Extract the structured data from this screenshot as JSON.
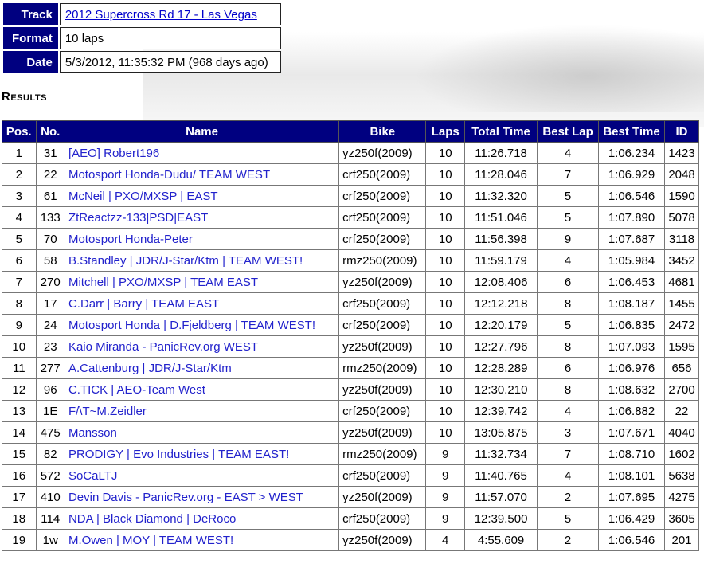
{
  "info": {
    "track_label": "Track",
    "track_value": "2012 Supercross Rd 17 - Las Vegas",
    "format_label": "Format",
    "format_value": "10 laps",
    "date_label": "Date",
    "date_value": "5/3/2012, 11:35:32 PM (968 days ago)"
  },
  "results": {
    "title": "Results",
    "headers": [
      "Pos.",
      "No.",
      "Name",
      "Bike",
      "Laps",
      "Total Time",
      "Best Lap",
      "Best Time",
      "ID"
    ],
    "rows": [
      [
        "1",
        "31",
        "[AEO] Robert196",
        "yz250f(2009)",
        "10",
        "11:26.718",
        "4",
        "1:06.234",
        "1423"
      ],
      [
        "2",
        "22",
        "Motosport Honda-Dudu/ TEAM WEST",
        "crf250(2009)",
        "10",
        "11:28.046",
        "7",
        "1:06.929",
        "2048"
      ],
      [
        "3",
        "61",
        "McNeil | PXO/MXSP | EAST",
        "crf250(2009)",
        "10",
        "11:32.320",
        "5",
        "1:06.546",
        "1590"
      ],
      [
        "4",
        "133",
        "ZtReactzz-133|PSD|EAST",
        "crf250(2009)",
        "10",
        "11:51.046",
        "5",
        "1:07.890",
        "5078"
      ],
      [
        "5",
        "70",
        "Motosport Honda-Peter",
        "crf250(2009)",
        "10",
        "11:56.398",
        "9",
        "1:07.687",
        "3118"
      ],
      [
        "6",
        "58",
        "B.Standley | JDR/J-Star/Ktm | TEAM WEST!",
        "rmz250(2009)",
        "10",
        "11:59.179",
        "4",
        "1:05.984",
        "3452"
      ],
      [
        "7",
        "270",
        "Mitchell | PXO/MXSP | TEAM EAST",
        "yz250f(2009)",
        "10",
        "12:08.406",
        "6",
        "1:06.453",
        "4681"
      ],
      [
        "8",
        "17",
        "C.Darr | Barry | TEAM EAST",
        "crf250(2009)",
        "10",
        "12:12.218",
        "8",
        "1:08.187",
        "1455"
      ],
      [
        "9",
        "24",
        "Motosport Honda | D.Fjeldberg | TEAM WEST!",
        "crf250(2009)",
        "10",
        "12:20.179",
        "5",
        "1:06.835",
        "2472"
      ],
      [
        "10",
        "23",
        "Kaio Miranda - PanicRev.org WEST",
        "yz250f(2009)",
        "10",
        "12:27.796",
        "8",
        "1:07.093",
        "1595"
      ],
      [
        "11",
        "277",
        "A.Cattenburg | JDR/J-Star/Ktm",
        "rmz250(2009)",
        "10",
        "12:28.289",
        "6",
        "1:06.976",
        "656"
      ],
      [
        "12",
        "96",
        "C.TICK | AEO-Team West",
        "yz250f(2009)",
        "10",
        "12:30.210",
        "8",
        "1:08.632",
        "2700"
      ],
      [
        "13",
        "1E",
        "F/\\T~M.Zeidler",
        "crf250(2009)",
        "10",
        "12:39.742",
        "4",
        "1:06.882",
        "22"
      ],
      [
        "14",
        "475",
        "Mansson",
        "yz250f(2009)",
        "10",
        "13:05.875",
        "3",
        "1:07.671",
        "4040"
      ],
      [
        "15",
        "82",
        "PRODIGY | Evo Industries | TEAM EAST!",
        "rmz250(2009)",
        "9",
        "11:32.734",
        "7",
        "1:08.710",
        "1602"
      ],
      [
        "16",
        "572",
        "SoCaLTJ",
        "crf250(2009)",
        "9",
        "11:40.765",
        "4",
        "1:08.101",
        "5638"
      ],
      [
        "17",
        "410",
        "Devin Davis - PanicRev.org - EAST > WEST",
        "yz250f(2009)",
        "9",
        "11:57.070",
        "2",
        "1:07.695",
        "4275"
      ],
      [
        "18",
        "114",
        "NDA | Black Diamond | DeRoco",
        "crf250(2009)",
        "9",
        "12:39.500",
        "5",
        "1:06.429",
        "3605"
      ],
      [
        "19",
        "1w",
        "M.Owen | MOY | TEAM WEST!",
        "yz250f(2009)",
        "4",
        "4:55.609",
        "2",
        "1:06.546",
        "201"
      ]
    ]
  },
  "colors": {
    "header_bg": "#000080",
    "header_text": "#ffffff",
    "link": "#2222cc"
  }
}
